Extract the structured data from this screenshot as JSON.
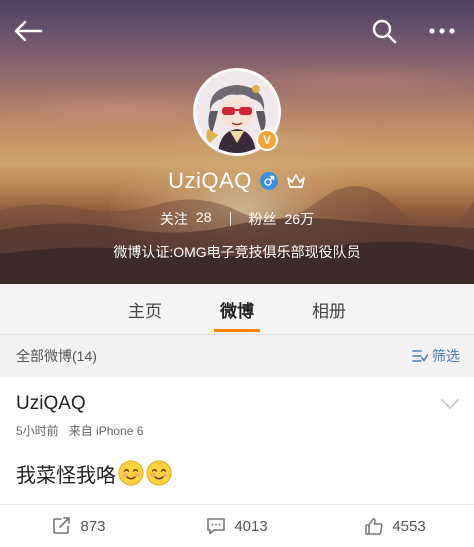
{
  "profile": {
    "username": "UziQAQ",
    "avatar_badge": "V",
    "following_label": "关注",
    "following_count": "28",
    "fans_label": "粉丝",
    "fans_count": "26万",
    "verification": "微博认证:OMG电子竞技俱乐部现役队员"
  },
  "topbar": {
    "back_icon": "back-arrow-icon",
    "search_icon": "search-icon",
    "more_icon": "more-dots-icon"
  },
  "tabs": [
    {
      "label": "主页",
      "active": false
    },
    {
      "label": "微博",
      "active": true
    },
    {
      "label": "相册",
      "active": false
    }
  ],
  "filter_bar": {
    "all_posts": "全部微博(14)",
    "filter_label": "筛选"
  },
  "post": {
    "author": "UziQAQ",
    "time": "5小时前",
    "source": "来自 iPhone 6",
    "text": "我菜怪我咯",
    "repost_count": "873",
    "comment_count": "4013",
    "like_count": "4553"
  },
  "colors": {
    "accent_orange": "#ff8200",
    "filter_blue": "#4d7ab5",
    "gender_blue": "#3b8fe0",
    "badge_orange": "#f3a33a"
  }
}
